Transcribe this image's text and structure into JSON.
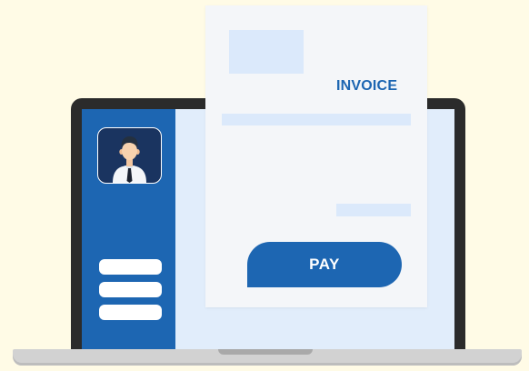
{
  "invoice": {
    "title": "INVOICE",
    "pay_label": "PAY"
  },
  "sidebar": {
    "avatar_icon": "user-avatar-icon",
    "menu_icon": "menu-lines-icon"
  },
  "colors": {
    "background": "#fffbe6",
    "accent": "#1d66b2",
    "light_accent": "#dbe9fb",
    "document": "#f4f6f9",
    "laptop_frame": "#2b2b2b"
  }
}
